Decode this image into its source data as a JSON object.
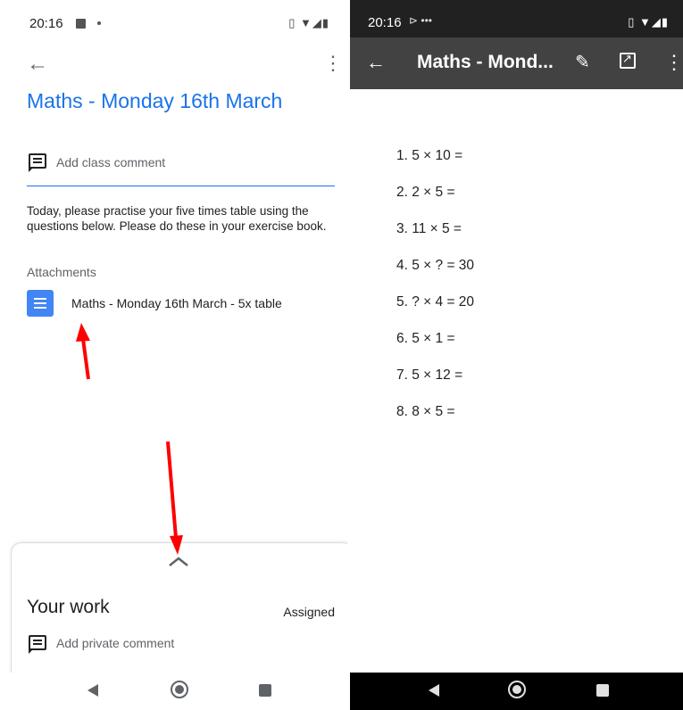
{
  "left": {
    "status": {
      "time": "20:16"
    },
    "title": "Maths - Monday 16th March",
    "comment_placeholder": "Add class comment",
    "description": "Today, please practise your five times table using the questions below. Please do these in your exercise book.",
    "attachments_label": "Attachments",
    "attachment_name": "Maths - Monday 16th March - 5x table",
    "sheet": {
      "title": "Your work",
      "status": "Assigned",
      "private_comment": "Add private comment"
    }
  },
  "right": {
    "status": {
      "time": "20:16"
    },
    "title": "Maths - Mond...",
    "questions": [
      "1.  5 × 10 =",
      "2.  2 × 5 =",
      "3.  11 × 5 =",
      "4.  5 × ? = 30",
      "5.  ? × 4 = 20",
      "6.  5 × 1 =",
      "7.  5 × 12 =",
      "8.  8 × 5 ="
    ]
  },
  "colors": {
    "accent_blue": "#1a73e8",
    "doc_icon_blue": "#4285f4",
    "appbar_gray": "#424242",
    "arrow_red": "#ff0000"
  },
  "icons": {
    "left": [
      "image-icon",
      "back-arrow-icon",
      "more-vert-icon",
      "comment-icon",
      "docs-icon",
      "chevron-up-icon"
    ],
    "right": [
      "cast-icon",
      "back-arrow-icon",
      "edit-pencil-icon",
      "open-external-icon",
      "more-vert-icon"
    ]
  }
}
